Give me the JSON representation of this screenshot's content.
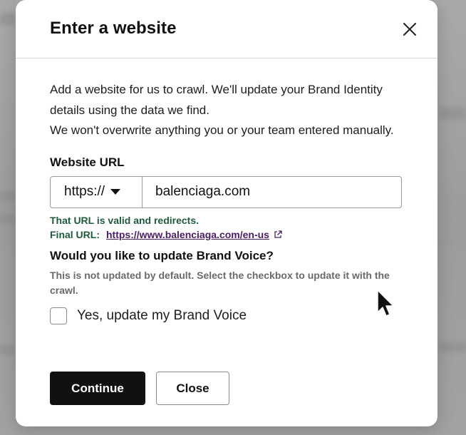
{
  "dialog": {
    "title": "Enter a website",
    "close_icon": "close-icon",
    "description_line1": "Add a website for us to crawl. We'll update your Brand Identity details using the data we find.",
    "description_line2": "We won't overwrite anything you or your team entered manually."
  },
  "url_field": {
    "label": "Website URL",
    "protocol": "https://",
    "value": "balenciaga.com"
  },
  "validation": {
    "message": "That URL is valid and redirects.",
    "final_label": "Final URL:",
    "final_url": "https://www.balenciaga.com/en-us",
    "link_icon": "external-link-icon",
    "color_success": "#1f5a3a",
    "color_link": "#4a1d63"
  },
  "brand_voice": {
    "question": "Would you like to update Brand Voice?",
    "help": "This is not updated by default. Select the checkbox to update it with the crawl.",
    "checkbox_label": "Yes, update my Brand Voice",
    "checked": false
  },
  "actions": {
    "continue_label": "Continue",
    "close_label": "Close"
  }
}
